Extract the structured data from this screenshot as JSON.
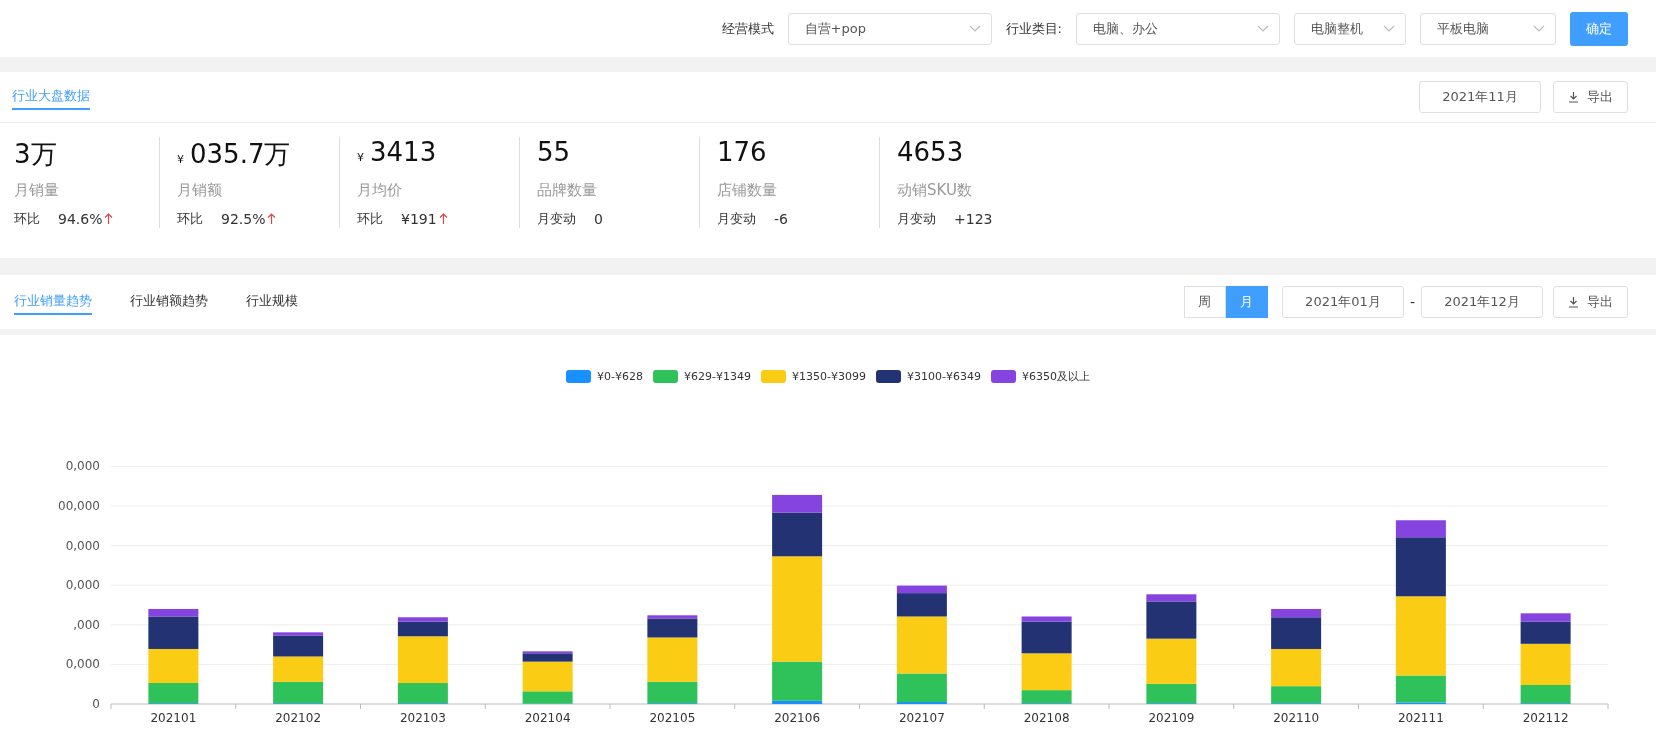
{
  "filters": {
    "items": [
      {
        "label": "经营模式",
        "value": "自营+pop"
      },
      {
        "label": "行业类目:",
        "value": "电脑、办公"
      },
      {
        "value": "电脑整机"
      },
      {
        "value": "平板电脑"
      }
    ],
    "confirm": "确定"
  },
  "overview": {
    "tab": "行业大盘数据",
    "date": "2021年11月",
    "export": "导出",
    "metrics": [
      {
        "value": "3万",
        "label": "月销量",
        "change_label": "环比",
        "change": "94.6%",
        "up": true
      },
      {
        "currency": "¥",
        "value": "035.7万",
        "label": "月销额",
        "change_label": "环比",
        "change": "92.5%",
        "up": true
      },
      {
        "currency": "¥",
        "value": "3413",
        "label": "月均价",
        "change_label": "环比",
        "change": "¥191",
        "up": true
      },
      {
        "value": "55",
        "label": "品牌数量",
        "change_label": "月变动",
        "change": "0",
        "up": false
      },
      {
        "value": "176",
        "label": "店铺数量",
        "change_label": "月变动",
        "change": "-6",
        "up": false
      },
      {
        "value": "4653",
        "label": "动销SKU数",
        "change_label": "月变动",
        "change": "+123",
        "up": false
      }
    ]
  },
  "trend": {
    "tabs": [
      {
        "label": "行业销量趋势",
        "selected": true
      },
      {
        "label": "行业销额趋势",
        "selected": false
      },
      {
        "label": "行业规模",
        "selected": false
      }
    ],
    "period": [
      {
        "label": "周",
        "selected": false
      },
      {
        "label": "月",
        "selected": true
      }
    ],
    "date_from": "2021年01月",
    "date_sep": "-",
    "date_to": "2021年12月",
    "export": "导出",
    "y_axis_labels": [
      "0,000",
      "00,000",
      "0,000",
      "0,000",
      ",000",
      "0,000",
      "0"
    ],
    "legend": [
      {
        "name": "¥0-¥628",
        "color": "#1890ff"
      },
      {
        "name": "¥629-¥1349",
        "color": "#2fc25b"
      },
      {
        "name": "¥1350-¥3099",
        "color": "#facc14"
      },
      {
        "name": "¥3100-¥6349",
        "color": "#223273"
      },
      {
        "name": "¥6350及以上",
        "color": "#8543e0"
      }
    ],
    "x_labels": [
      "202101",
      "202102",
      "202103",
      "202104",
      "202105",
      "202106",
      "202107",
      "202108",
      "202109",
      "202110",
      "202111",
      "202112"
    ]
  }
}
